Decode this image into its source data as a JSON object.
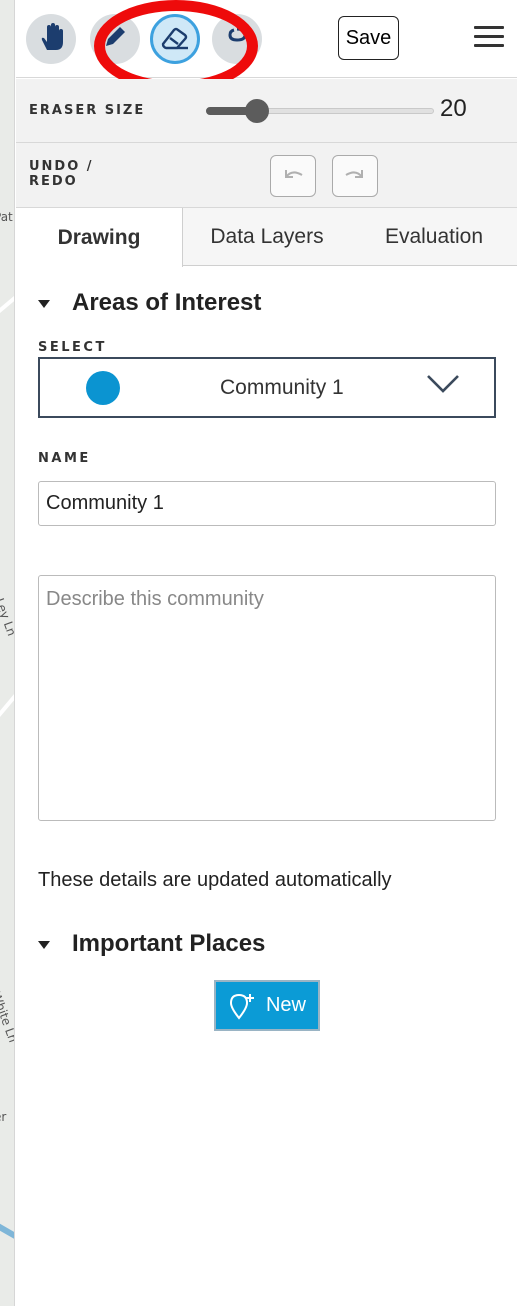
{
  "map": {
    "labels": [
      "Pat",
      "Ley Ln",
      "White Ln",
      "er"
    ]
  },
  "toolbar": {
    "tools": [
      {
        "name": "pan",
        "icon": "hand-icon"
      },
      {
        "name": "draw",
        "icon": "pencil-icon"
      },
      {
        "name": "eraser",
        "icon": "eraser-icon",
        "active": true
      },
      {
        "name": "lasso",
        "icon": "lasso-icon"
      }
    ],
    "save_label": "Save",
    "menu_icon": "hamburger-icon"
  },
  "eraser": {
    "label": "ERASER SIZE",
    "value": "20",
    "fraction": 0.2
  },
  "undo_redo": {
    "label_line1": "UNDO /",
    "label_line2": "REDO"
  },
  "tabs": [
    {
      "label": "Drawing",
      "active": true
    },
    {
      "label": "Data Layers"
    },
    {
      "label": "Evaluation"
    }
  ],
  "areas": {
    "heading": "Areas of Interest",
    "select_label": "SELECT",
    "selected_value": "Community 1",
    "selected_color": "#0b94d1",
    "name_label": "NAME",
    "name_value": "Community 1",
    "description_placeholder": "Describe this community",
    "note": "These details are updated automatically"
  },
  "places": {
    "heading": "Important Places",
    "new_label": "New",
    "new_icon": "map-pin-plus-icon"
  }
}
